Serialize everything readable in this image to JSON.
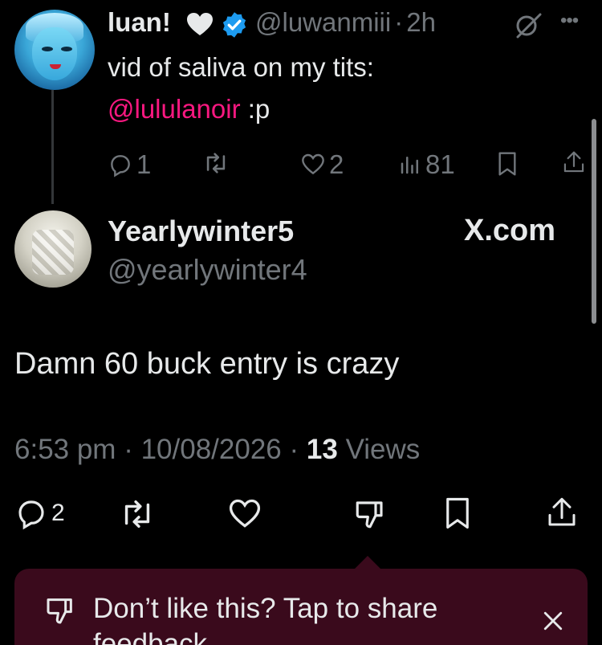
{
  "parent_tweet": {
    "display_name": "luan!",
    "handle": "@luwanmiii",
    "separator": "·",
    "time": "2h",
    "text_line1": "vid of saliva on my tits:",
    "mention": "@lululanoir",
    "text_after_mention": " :p",
    "replies": "1",
    "likes": "2",
    "views": "81"
  },
  "reply_tweet": {
    "display_name": "Yearlywinter5",
    "handle": "@yearlywinter4",
    "label": "X.com",
    "text": "Damn 60 buck entry is crazy",
    "time": "6:53 pm",
    "date": "10/08/2026",
    "views_count": "13",
    "views_label": "Views",
    "replies": "2"
  },
  "feedback_popup": {
    "text": "Don’t like this? Tap to share feedback"
  },
  "colors": {
    "background": "#000000",
    "mention": "#f91880",
    "verified": "#1d9bf0",
    "muted": "#71767b",
    "popup": "#3a0a1c"
  }
}
